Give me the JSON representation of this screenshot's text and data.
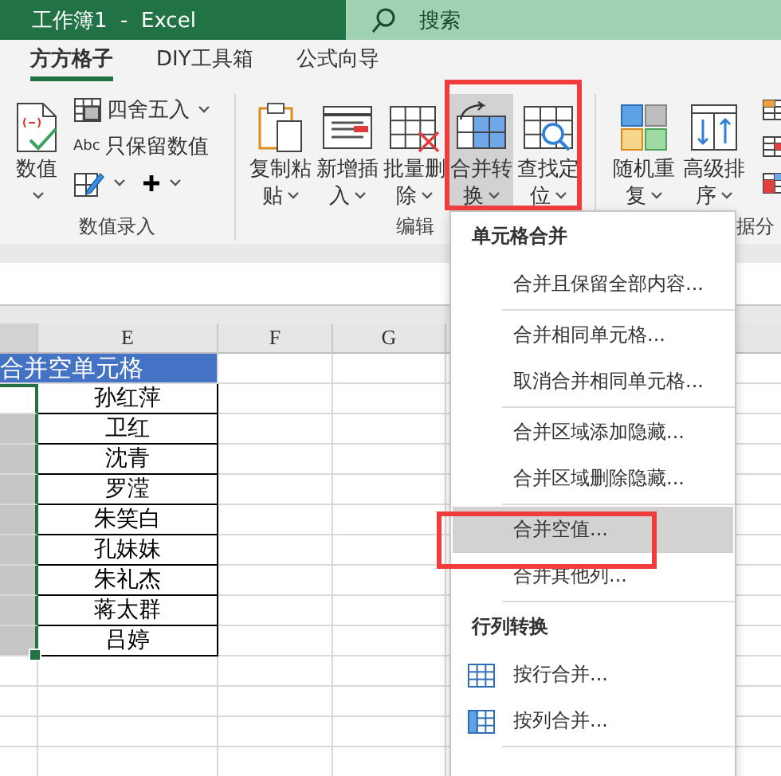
{
  "window": {
    "title": "工作簿1  -  Excel"
  },
  "search": {
    "placeholder": "搜索"
  },
  "tabs": [
    {
      "label": "方方格子",
      "selected": true
    },
    {
      "label": "DIY工具箱",
      "selected": false
    },
    {
      "label": "公式向导",
      "selected": false
    }
  ],
  "ribbon": {
    "groups": [
      {
        "label": "数值录入",
        "items": [
          {
            "kind": "large",
            "label": "数值",
            "dropdown": true,
            "pressed": false
          },
          {
            "kind": "stack",
            "rows": [
              [
                {
                  "kind": "small",
                  "label": "四舍五入",
                  "dropdown": true
                }
              ],
              [
                {
                  "kind": "small",
                  "label": "只保留数值",
                  "badge": "Abc",
                  "dropdown": false
                }
              ],
              [
                {
                  "kind": "tool",
                  "dropdown": true
                },
                {
                  "kind": "tool",
                  "dropdown": true
                }
              ]
            ]
          }
        ]
      },
      {
        "label": "编辑",
        "items": [
          {
            "kind": "large",
            "label": "复制粘贴",
            "dropdown": true,
            "pressed": false
          },
          {
            "kind": "large",
            "label": "新增插入",
            "dropdown": true,
            "pressed": false
          },
          {
            "kind": "large",
            "label": "批量删除",
            "dropdown": true,
            "pressed": false
          },
          {
            "kind": "large",
            "label": "合并转换",
            "dropdown": true,
            "pressed": true
          },
          {
            "kind": "large",
            "label": "查找定位",
            "dropdown": true,
            "pressed": false
          }
        ]
      },
      {
        "label": "据分",
        "items": [
          {
            "kind": "large",
            "label": "随机重复",
            "dropdown": true,
            "pressed": false
          },
          {
            "kind": "large",
            "label": "高级排序",
            "dropdown": true,
            "pressed": false
          },
          {
            "kind": "stack",
            "rows": [
              [
                {
                  "kind": "tool",
                  "dropdown": false
                }
              ],
              [
                {
                  "kind": "tool",
                  "dropdown": false
                }
              ],
              [
                {
                  "kind": "tool",
                  "dropdown": false
                }
              ]
            ]
          }
        ]
      }
    ]
  },
  "sheet": {
    "columns": [
      {
        "label": "E"
      },
      {
        "label": "F"
      },
      {
        "label": "G"
      }
    ],
    "title": "合并空单元格",
    "rows": [
      {
        "name": "孙红萍",
        "selected": true,
        "active": true
      },
      {
        "name": "卫红",
        "selected": true,
        "active": false
      },
      {
        "name": "沈青",
        "selected": true,
        "active": false
      },
      {
        "name": "罗滢",
        "selected": true,
        "active": false
      },
      {
        "name": "朱笑白",
        "selected": true,
        "active": false
      },
      {
        "name": "孔妹妹",
        "selected": true,
        "active": false
      },
      {
        "name": "朱礼杰",
        "selected": true,
        "active": false
      },
      {
        "name": "蒋太群",
        "selected": true,
        "active": false
      },
      {
        "name": "吕婷",
        "selected": true,
        "active": false
      }
    ]
  },
  "menu": {
    "sections": [
      {
        "title": "单元格合并",
        "groups": [
          [
            {
              "label": "合并且保留全部内容...",
              "kind": "plain",
              "selected": false
            }
          ],
          [
            {
              "label": "合并相同单元格...",
              "kind": "plain",
              "selected": false
            },
            {
              "label": "取消合并相同单元格...",
              "kind": "plain",
              "selected": false
            }
          ],
          [
            {
              "label": "合并区域添加隐藏...",
              "kind": "plain",
              "selected": false
            },
            {
              "label": "合并区域删除隐藏...",
              "kind": "plain",
              "selected": false
            }
          ],
          [
            {
              "label": "合并空值...",
              "kind": "plain",
              "selected": true
            },
            {
              "label": "合并其他列...",
              "kind": "plain",
              "selected": false
            }
          ]
        ]
      },
      {
        "title": "行列转换",
        "groups": [
          [
            {
              "label": "按行合并...",
              "kind": "byrow",
              "selected": false
            },
            {
              "label": "按列合并...",
              "kind": "bycolumn",
              "selected": false
            }
          ]
        ]
      }
    ]
  }
}
